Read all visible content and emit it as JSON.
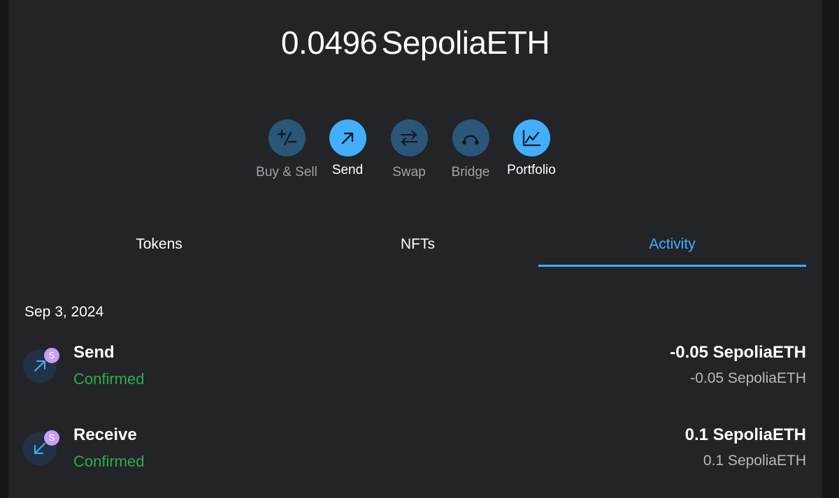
{
  "balance": {
    "amount": "0.0496",
    "unit": "SepoliaETH"
  },
  "actions": [
    {
      "label": "Buy & Sell",
      "icon": "plus-minus-icon"
    },
    {
      "label": "Send",
      "icon": "arrow-up-right-icon"
    },
    {
      "label": "Swap",
      "icon": "swap-arrows-icon"
    },
    {
      "label": "Bridge",
      "icon": "bridge-icon"
    },
    {
      "label": "Portfolio",
      "icon": "chart-icon"
    }
  ],
  "tabs": [
    {
      "label": "Tokens"
    },
    {
      "label": "NFTs"
    },
    {
      "label": "Activity"
    }
  ],
  "activity": {
    "date": "Sep 3, 2024",
    "transactions": [
      {
        "title": "Send",
        "status": "Confirmed",
        "primary_amount": "-0.05 SepoliaETH",
        "secondary_amount": "-0.05 SepoliaETH",
        "network_badge": "S",
        "icon": "arrow-up-right-icon"
      },
      {
        "title": "Receive",
        "status": "Confirmed",
        "primary_amount": "0.1 SepoliaETH",
        "secondary_amount": "0.1 SepoliaETH",
        "network_badge": "S",
        "icon": "arrow-down-left-icon"
      }
    ]
  },
  "colors": {
    "accent": "#43aefc",
    "success": "#2fab51",
    "background": "#222427",
    "muted_button": "#2c5678",
    "network_badge": "#c79ef6"
  }
}
